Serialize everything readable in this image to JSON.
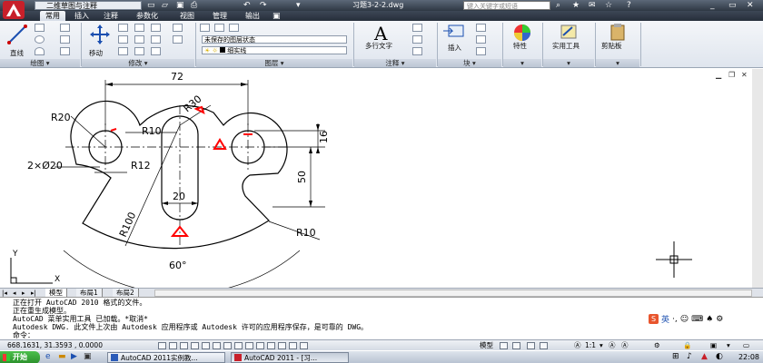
{
  "titlebar": {
    "workspace": "二维草图与注释",
    "title": "习题3-2-2.dwg",
    "search_placeholder": "键入关键字或短语"
  },
  "ribbon": {
    "tabs": [
      "常用",
      "插入",
      "注释",
      "参数化",
      "视图",
      "管理",
      "输出"
    ],
    "draw": {
      "line_label": "直线",
      "panel": "绘图"
    },
    "modify": {
      "move_label": "移动",
      "panel": "修改"
    },
    "layers": {
      "state_label": "未保存的图层状态",
      "linetype_label": "细实线",
      "panel": "图层"
    },
    "annotation": {
      "mtext_label": "多行文字",
      "panel": "注释"
    },
    "block": {
      "insert_label": "插入",
      "panel": "块"
    },
    "properties_label": "特性",
    "utilities_label": "实用工具",
    "clipboard_label": "剪贴板"
  },
  "drawing": {
    "dims": {
      "d72": "72",
      "r20": "R20",
      "r10_top": "R10",
      "r30": "R30",
      "holes": "2×Ø20",
      "r12": "R12",
      "d16": "16",
      "d50": "50",
      "d20": "20",
      "r100": "R100",
      "r10_bottom": "R10",
      "angle": "60°"
    },
    "ucs_y": "Y",
    "ucs_x": "X"
  },
  "layout_tabs": [
    "模型",
    "布局1",
    "布局2"
  ],
  "command": {
    "lines": [
      "正在打开 AutoCAD 2010 格式的文件。",
      "正在重生成模型。",
      "AutoCAD 菜单实用工具 已加载。*取消*",
      "Autodesk DWG.   此文件上次由 Autodesk 应用程序或 Autodesk 许可的应用程序保存，是可靠的 DWG。",
      "命令："
    ]
  },
  "statusbar": {
    "coords": "668.1631, 31.3593 , 0.0000",
    "model": "模型",
    "scale": "1:1"
  },
  "ime": {
    "label": "英"
  },
  "taskbar": {
    "start": "开始",
    "tasks": [
      "AutoCAD 2011实例教...",
      "AutoCAD 2011 - [习..."
    ],
    "clock": "22:08"
  },
  "colors": {
    "annotation_red": "#ff0000",
    "ribbon_dark": "#2e3844"
  }
}
